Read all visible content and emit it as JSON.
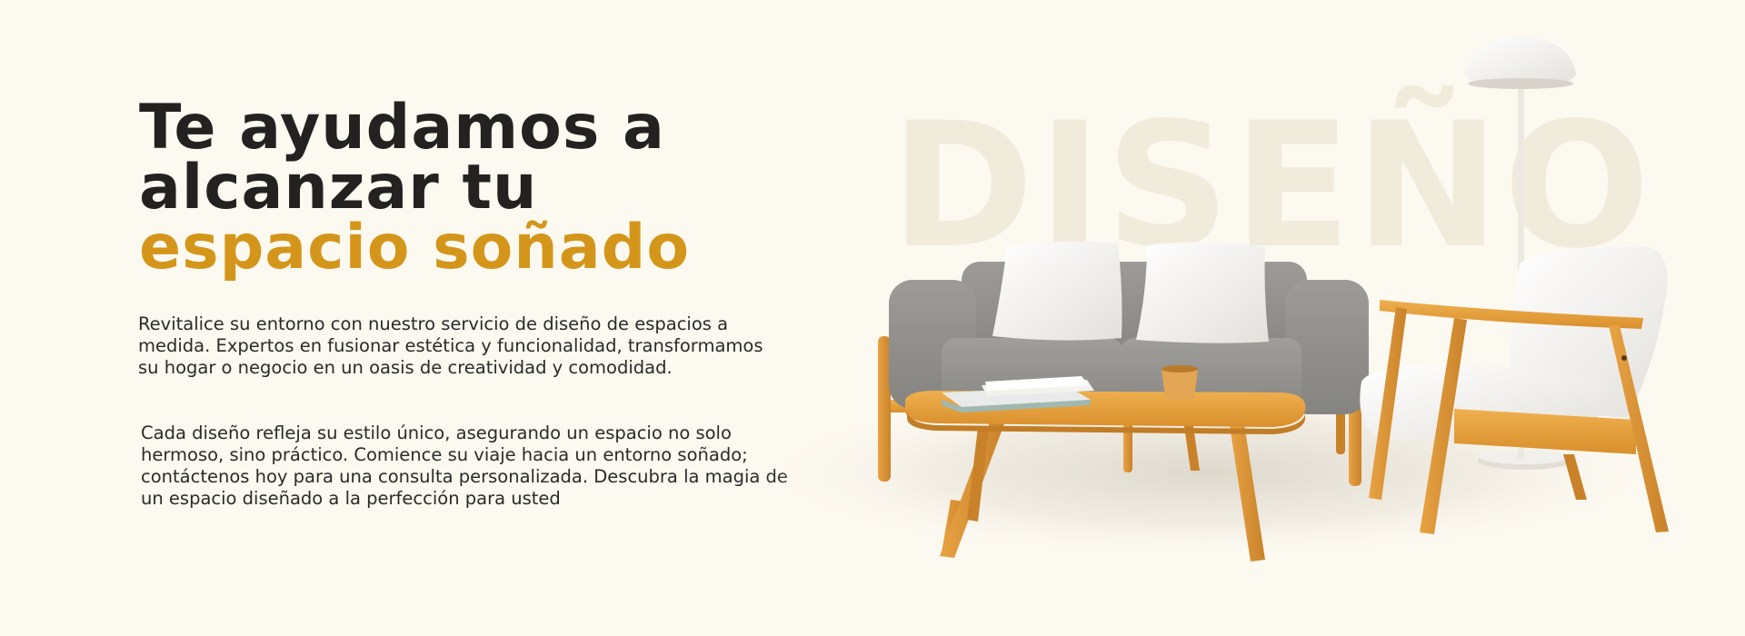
{
  "hero": {
    "headline_line1": "Te ayudamos a",
    "headline_line2": "alcanzar tu",
    "headline_accent": "espacio soñado",
    "paragraph1": "Revitalice su entorno con nuestro servicio de diseño de espacios a medida. Expertos en fusionar estética y funcionalidad, transformamos su hogar o negocio en un oasis de creatividad y comodidad.",
    "paragraph2": "Cada diseño refleja su estilo único, asegurando un espacio no solo hermoso, sino práctico. Comience su viaje hacia un entorno soñado; contáctenos hoy para una consulta personalizada. Descubra la magia de un espacio diseñado a la perfección para usted",
    "background_word": "DISEÑO"
  },
  "colors": {
    "background": "#fcf9f1",
    "text": "#242220",
    "accent": "#d4961a",
    "watermark": "#f1ebdc"
  }
}
